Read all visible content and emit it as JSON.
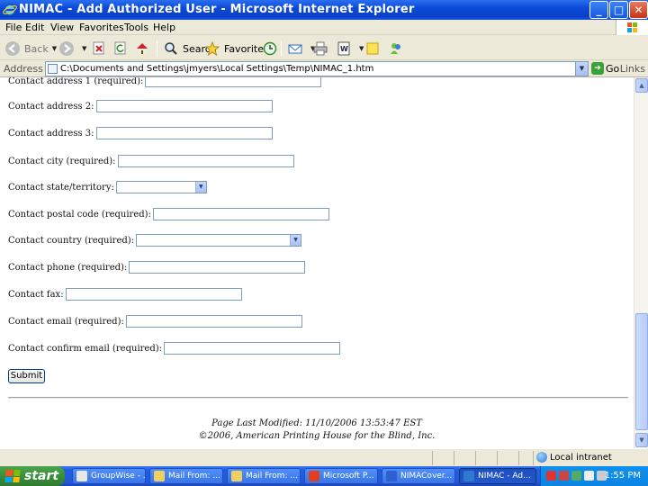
{
  "window": {
    "title": "NIMAC - Add Authorized User - Microsoft Internet Explorer",
    "minimize_glyph": "_",
    "maximize_glyph": "□",
    "close_glyph": "✕"
  },
  "menu": [
    "File",
    "Edit",
    "View",
    "Favorites",
    "Tools",
    "Help"
  ],
  "toolbar": {
    "back": "Back",
    "search": "Search",
    "favorites": "Favorites"
  },
  "address": {
    "label": "Address",
    "value": "C:\\Documents and Settings\\jmyers\\Local Settings\\Temp\\NIMAC_1.htm",
    "go": "Go",
    "links": "Links"
  },
  "form": {
    "fields": [
      {
        "label": "Contact address 1 (required):",
        "type": "text"
      },
      {
        "label": "Contact address 2:",
        "type": "text"
      },
      {
        "label": "Contact address 3:",
        "type": "text"
      },
      {
        "label": "Contact city (required):",
        "type": "text"
      },
      {
        "label": "Contact state/territory:",
        "type": "select"
      },
      {
        "label": "Contact postal code (required):",
        "type": "text"
      },
      {
        "label": "Contact country (required):",
        "type": "select"
      },
      {
        "label": "Contact phone (required):",
        "type": "text"
      },
      {
        "label": "Contact fax:",
        "type": "text"
      },
      {
        "label": "Contact email (required):",
        "type": "text"
      },
      {
        "label": "Contact confirm email (required):",
        "type": "text"
      }
    ],
    "submit_label": "Submit"
  },
  "footer": {
    "modified": "Page Last Modified: 11/10/2006 13:53:47 EST",
    "copyright": "©2006, American Printing House for the Blind, Inc."
  },
  "status": {
    "zone": "Local intranet"
  },
  "taskbar": {
    "start": "start",
    "tasks": [
      {
        "label": "GroupWise - ...",
        "color": "#e8e8e8"
      },
      {
        "label": "Mail From: ...",
        "color": "#f0d060"
      },
      {
        "label": "Mail From: ...",
        "color": "#f0d060"
      },
      {
        "label": "Microsoft P...",
        "color": "#e04020"
      },
      {
        "label": "NIMACover...",
        "color": "#3060d0"
      },
      {
        "label": "NIMAC - Ad...",
        "color": "#2f7ad1"
      }
    ],
    "clock": "1:55 PM"
  }
}
